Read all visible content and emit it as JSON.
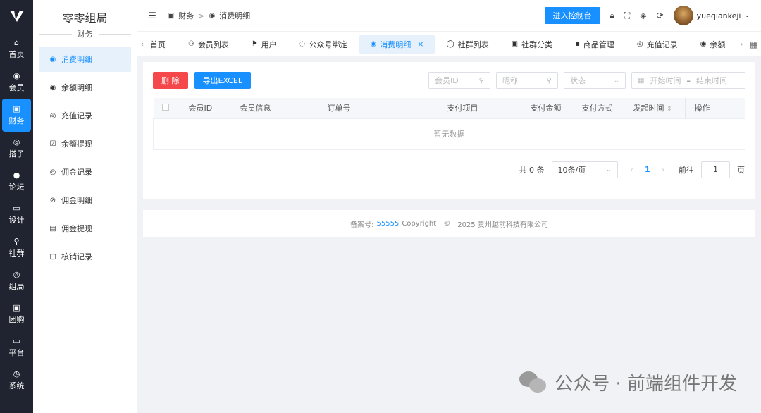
{
  "rail": [
    {
      "icon": "home-icon",
      "glyph": "⌂",
      "label": "首页"
    },
    {
      "icon": "user-icon",
      "glyph": "◉",
      "label": "会员"
    },
    {
      "icon": "finance-icon",
      "glyph": "▣",
      "label": "财务",
      "active": true
    },
    {
      "icon": "partner-icon",
      "glyph": "◎",
      "label": "搭子"
    },
    {
      "icon": "forum-icon",
      "glyph": "●",
      "label": "论坛"
    },
    {
      "icon": "monitor-icon",
      "glyph": "▭",
      "label": "设计"
    },
    {
      "icon": "community-icon",
      "glyph": "⚲",
      "label": "社群"
    },
    {
      "icon": "group-icon",
      "glyph": "◎",
      "label": "组局"
    },
    {
      "icon": "bag-icon",
      "glyph": "▣",
      "label": "团购"
    },
    {
      "icon": "platform-icon",
      "glyph": "▭",
      "label": "平台"
    },
    {
      "icon": "clock-icon",
      "glyph": "◷",
      "label": "系统"
    }
  ],
  "submenu": {
    "title": "零零组局",
    "section": "财务",
    "items": [
      {
        "icon": "consume-icon",
        "glyph": "◉",
        "label": "消费明细",
        "active": true
      },
      {
        "icon": "balance-icon",
        "glyph": "◉",
        "label": "余额明细"
      },
      {
        "icon": "recharge-icon",
        "glyph": "◎",
        "label": "充值记录"
      },
      {
        "icon": "withdraw-icon",
        "glyph": "☑",
        "label": "余额提现"
      },
      {
        "icon": "commission-icon",
        "glyph": "◎",
        "label": "佣金记录"
      },
      {
        "icon": "commission-detail-icon",
        "glyph": "⊘",
        "label": "佣金明细"
      },
      {
        "icon": "commission-withdraw-icon",
        "glyph": "▤",
        "label": "佣金提现"
      },
      {
        "icon": "verify-icon",
        "glyph": "▢",
        "label": "核销记录"
      }
    ]
  },
  "header": {
    "breadcrumb_root": "财务",
    "breadcrumb_sep": ">",
    "breadcrumb_current": "消费明细",
    "console_button": "进入控制台",
    "username": "yueqiankeji"
  },
  "tabs": [
    {
      "icon": "",
      "label": "首页"
    },
    {
      "icon": "person-icon",
      "glyph": "⚇",
      "label": "会员列表"
    },
    {
      "icon": "flag-icon",
      "glyph": "⚑",
      "label": "用户"
    },
    {
      "icon": "chat-icon",
      "glyph": "◌",
      "label": "公众号绑定"
    },
    {
      "icon": "consume-icon",
      "glyph": "◉",
      "label": "消费明细",
      "active": true
    },
    {
      "icon": "comment-icon",
      "glyph": "◯",
      "label": "社群列表"
    },
    {
      "icon": "category-icon",
      "glyph": "▣",
      "label": "社群分类"
    },
    {
      "icon": "goods-icon",
      "glyph": "▪",
      "label": "商品管理"
    },
    {
      "icon": "recharge-icon",
      "glyph": "◎",
      "label": "充值记录"
    },
    {
      "icon": "balance-icon",
      "glyph": "◉",
      "label": "余额"
    }
  ],
  "toolbar": {
    "delete_label": "删 除",
    "export_label": "导出EXCEL",
    "member_id_placeholder": "会员ID",
    "nickname_placeholder": "昵称",
    "status_placeholder": "状态",
    "start_time_placeholder": "开始时间",
    "range_sep": "–",
    "end_time_placeholder": "结束时间"
  },
  "table": {
    "columns": [
      "会员ID",
      "会员信息",
      "订单号",
      "支付项目",
      "支付金额",
      "支付方式",
      "发起时间",
      "操作"
    ],
    "empty_text": "暂无数据"
  },
  "pagination": {
    "total_text": "共 0 条",
    "page_size": "10条/页",
    "current_page": "1",
    "goto_label": "前往",
    "goto_value": "1",
    "page_suffix": "页"
  },
  "footer": {
    "prefix": "备案号:",
    "record": "55555",
    "copyright": "Copyright",
    "copy_symbol": "©",
    "year_company": "2025 贵州越前科技有限公司"
  },
  "watermark": {
    "text": "公众号 · 前端组件开发"
  }
}
